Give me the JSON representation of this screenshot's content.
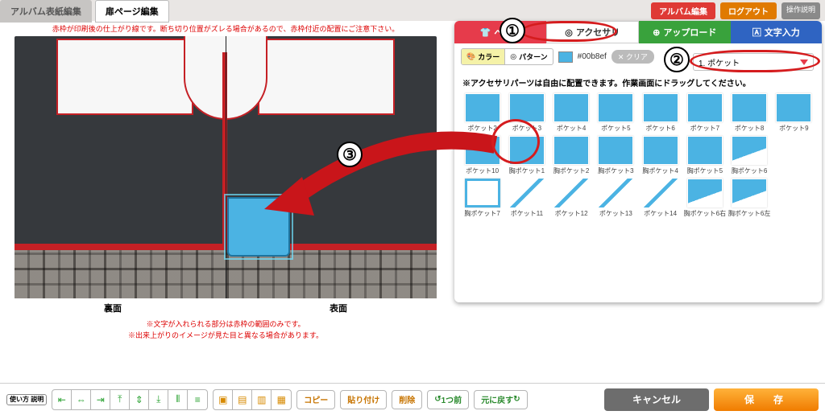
{
  "topbar": {
    "tab_edit_cover": "アルバム表紙編集",
    "tab_edit_page": "扉ページ編集",
    "btn_album": "アルバム編集",
    "btn_logout": "ログアウト",
    "btn_help": "操作説明"
  },
  "stage": {
    "top_note": "赤枠が印刷後の仕上がり線です。断ち切り位置がズレる場合があるので、赤枠付近の配置にご注意下さい。",
    "label_back": "裏面",
    "label_front": "表面",
    "bottom_note1": "※文字が入れられる部分は赤枠の範囲のみです。",
    "bottom_note2": "※出来上がりのイメージが見た目と異なる場合があります。"
  },
  "panel": {
    "tabs": {
      "base": "ベース",
      "accessory": "アクセサリ",
      "upload": "アップロード",
      "text": "文字入力"
    },
    "opt_color": "カラー",
    "opt_pattern": "パターン",
    "hex": "#00b8ef",
    "clear": "クリア",
    "dropdown": "1. ポケット",
    "note": "※アクセサリパーツは自由に配置できます。作業画面にドラッグしてください。",
    "items": [
      "ポケット2",
      "ポケット3",
      "ポケット4",
      "ポケット5",
      "ポケット6",
      "ポケット7",
      "ポケット8",
      "ポケット9",
      "ポケット10",
      "胸ポケット1",
      "胸ポケット2",
      "胸ポケット3",
      "胸ポケット4",
      "胸ポケット5",
      "胸ポケット6",
      "",
      "胸ポケット7",
      "ポケット11",
      "ポケット12",
      "ポケット13",
      "ポケット14",
      "胸ポケット6右",
      "胸ポケット6左"
    ]
  },
  "toolbar": {
    "help_chip": "使い方\n説明",
    "copy": "コピー",
    "paste": "貼り付け",
    "delete": "削除",
    "undo": "1つ前",
    "redo": "元に戻す",
    "cancel": "キャンセル",
    "save": "保　存"
  },
  "callouts": {
    "c1": "①",
    "c2": "②",
    "c3": "③"
  }
}
